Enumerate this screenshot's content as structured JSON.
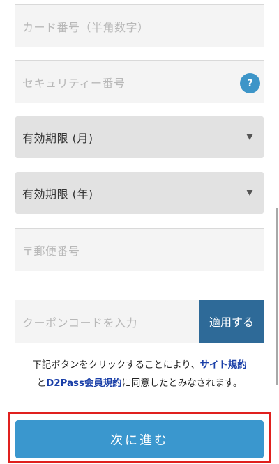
{
  "form": {
    "card_number_placeholder": "カード番号（半角数字）",
    "security_code_placeholder": "セキュリティー番号",
    "help_icon_label": "?",
    "expiry_month_value": "有効期限 (月)",
    "expiry_year_value": "有効期限 (年)",
    "postal_code_placeholder": "〒郵便番号"
  },
  "coupon": {
    "placeholder": "クーポンコードを入力",
    "apply_label": "適用する"
  },
  "terms": {
    "prefix": "下記ボタンをクリックすることにより、",
    "site_terms_link": "サイト規約",
    "and": "と",
    "d2pass_terms_link": "D2Pass会員規約",
    "suffix": "に同意したとみなされます。"
  },
  "actions": {
    "next_label": "次に進む"
  },
  "colors": {
    "primary_button": "#3a97ce",
    "apply_button": "#2e6a98",
    "highlight_frame": "#e0201e",
    "link": "#1a3fa8"
  }
}
